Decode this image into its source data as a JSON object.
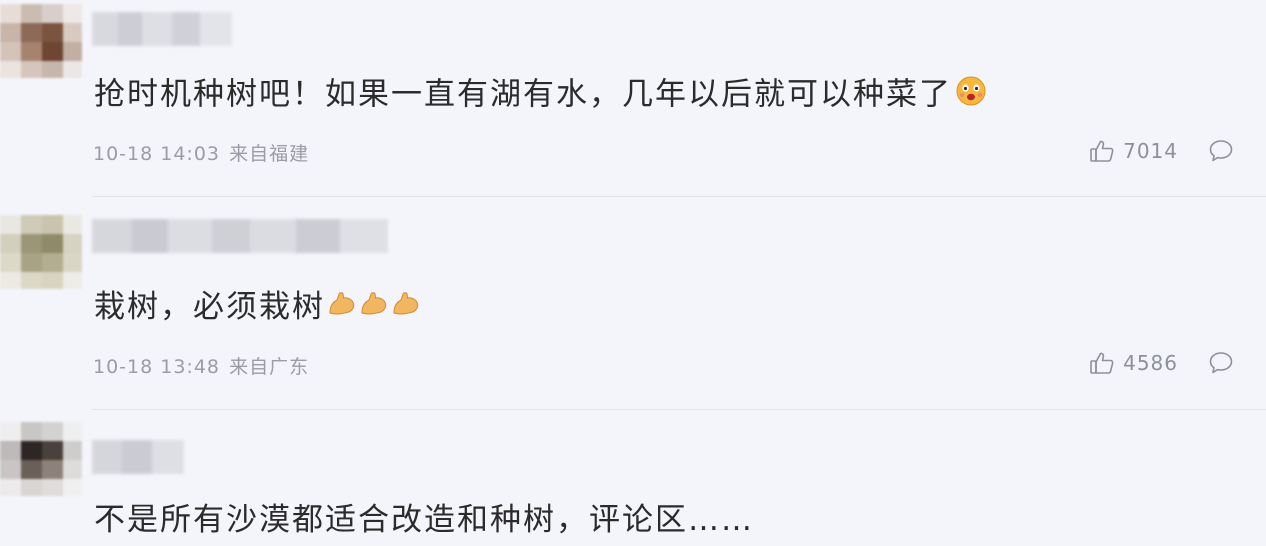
{
  "colors": {
    "background": "#f4f5fb",
    "text": "#2b2b2b",
    "meta": "#9a9ca6",
    "icon": "#8e909a"
  },
  "comments": [
    {
      "text": "抢时机种树吧！如果一直有湖有水，几年以后就可以种菜了",
      "emoji": [
        "face-emoji"
      ],
      "date": "10-18 14:03",
      "location": "来自福建",
      "likes": "7014"
    },
    {
      "text": "栽树，必须栽树",
      "emoji": [
        "flexed-biceps-emoji",
        "flexed-biceps-emoji",
        "flexed-biceps-emoji"
      ],
      "date": "10-18 13:48",
      "location": "来自广东",
      "likes": "4586"
    },
    {
      "text": "不是所有沙漠都适合改造和种树，评论区……",
      "emoji": []
    }
  ],
  "icons": {
    "like": "thumbs-up-icon",
    "reply": "comment-bubble-icon"
  }
}
